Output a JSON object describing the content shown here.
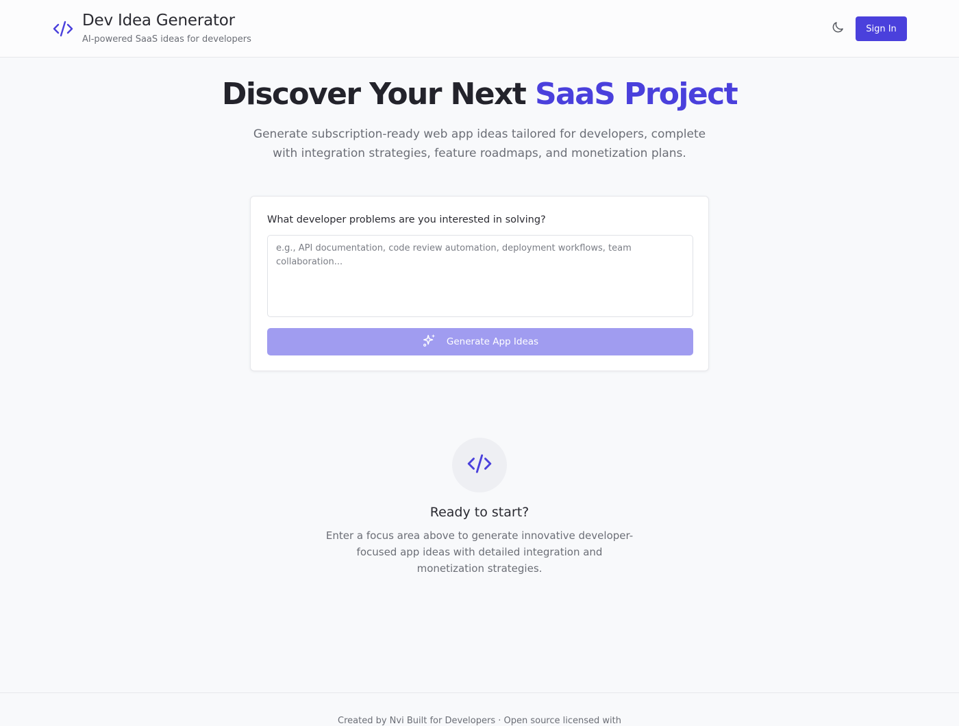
{
  "header": {
    "title": "Dev Idea Generator",
    "subtitle": "AI-powered SaaS ideas for developers",
    "theme_toggle_icon": "moon-icon",
    "signin_label": "Sign In",
    "brand_icon": "code-brackets-icon"
  },
  "hero": {
    "title_main": "Discover Your Next ",
    "title_accent": "SaaS Project",
    "subtitle": "Generate subscription-ready web app ideas tailored for developers, complete with integration strategies, feature roadmaps, and monetization plans."
  },
  "form": {
    "label": "What developer problems are you interested in solving?",
    "textarea_value": "",
    "textarea_placeholder": "e.g., API documentation, code review automation, deployment workflows, team collaboration...",
    "generate_label": "Generate App Ideas",
    "generate_icon": "sparkles-icon"
  },
  "empty_state": {
    "icon": "code-brackets-icon",
    "title": "Ready to start?",
    "description": "Enter a focus area above to generate innovative developer-focused app ideas with detailed integration and monetization strategies."
  },
  "footer": {
    "text": "Created by Nvi Built for Developers · Open source licensed with"
  },
  "colors": {
    "accent": "#4a40dc",
    "accent_disabled": "#a09cf0",
    "background": "#f8f9fb"
  }
}
